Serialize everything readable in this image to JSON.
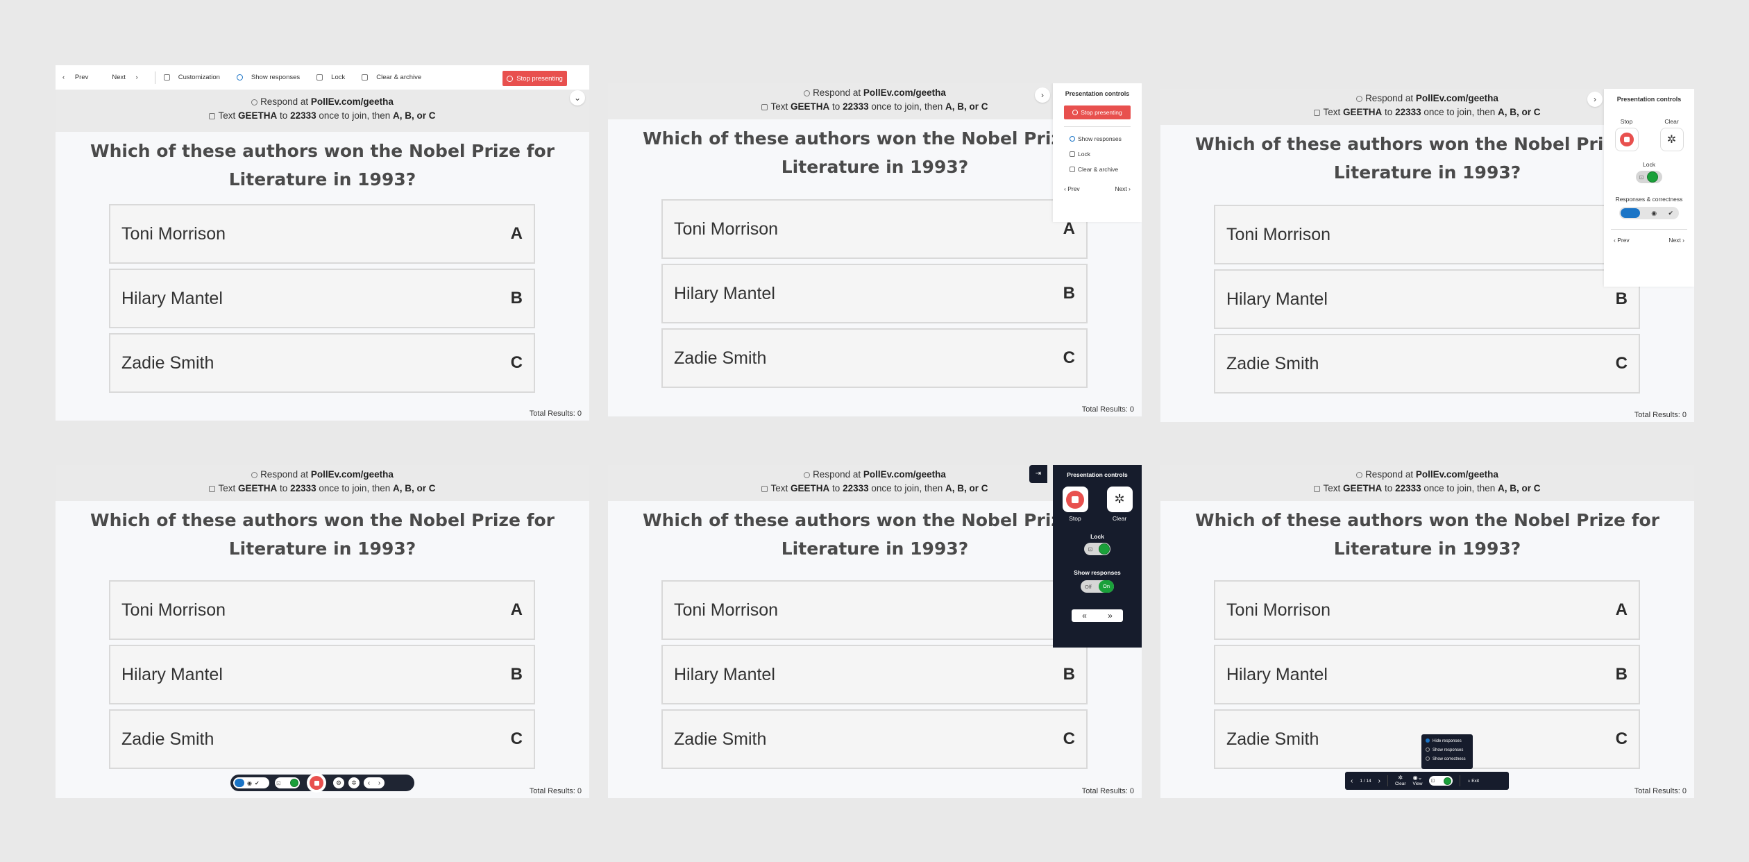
{
  "slide": {
    "respond_prefix": "Respond at",
    "respond_url": "PollEv.com/geetha",
    "text_prefix": "Text",
    "keyword": "GEETHA",
    "to": "to",
    "number": "22333",
    "join_suffix": "once to join, then",
    "choices_hint": "A, B, or C",
    "question": "Which of these authors won the Nobel Prize for Literature in 1993?",
    "options": [
      {
        "text": "Toni Morrison",
        "letter": "A"
      },
      {
        "text": "Hilary Mantel",
        "letter": "B"
      },
      {
        "text": "Zadie Smith",
        "letter": "C"
      }
    ],
    "total_results": "Total Results: 0"
  },
  "toolbar1": {
    "prev": "Prev",
    "next": "Next",
    "customization": "Customization",
    "show_responses": "Show responses",
    "lock": "Lock",
    "clear_archive": "Clear & archive",
    "stop_presenting": "Stop presenting"
  },
  "panel2_controls": {
    "title": "Presentation controls",
    "stop_presenting": "Stop presenting",
    "show_responses": "Show responses",
    "lock": "Lock",
    "clear_archive": "Clear & archive",
    "prev": "Prev",
    "next": "Next"
  },
  "panel3_controls": {
    "title": "Presentation controls",
    "stop": "Stop",
    "clear": "Clear",
    "lock": "Lock",
    "responses_correctness": "Responses & correctness",
    "prev": "Prev",
    "next": "Next"
  },
  "panel5_controls": {
    "title": "Presentation controls",
    "stop": "Stop",
    "clear": "Clear",
    "lock": "Lock",
    "show_responses": "Show responses",
    "off": "Off",
    "on": "On"
  },
  "panel6_bar": {
    "page": "1 / 14",
    "clear": "Clear",
    "view": "View",
    "exit": "Exit",
    "menu": [
      "Hide responses",
      "Show responses",
      "Show correctness"
    ]
  },
  "colors": {
    "stop_red": "#e8504e",
    "accent_blue": "#1a74c6",
    "lock_green": "#1aa03a",
    "dark_panel": "#161c2c"
  }
}
